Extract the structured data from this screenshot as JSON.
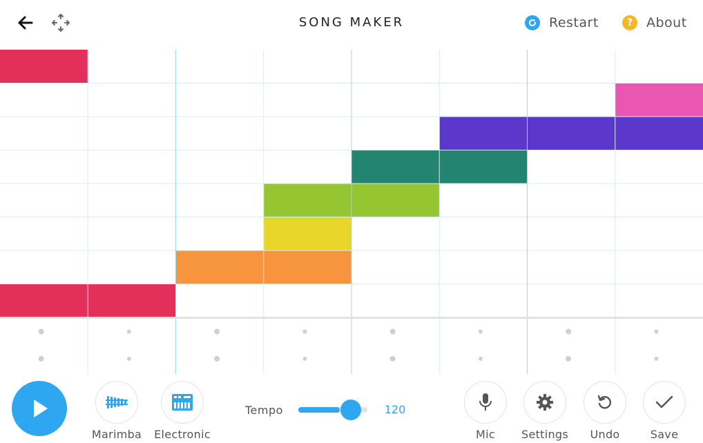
{
  "header": {
    "title": "SONG MAKER",
    "back_icon": "arrow-left-icon",
    "move_icon": "move-arrows-icon",
    "restart": {
      "label": "Restart",
      "icon": "restart-icon",
      "color": "#2fa6f0"
    },
    "about": {
      "label": "About",
      "icon": "question-icon",
      "icon_glyph": "?",
      "color": "#f5b62a"
    }
  },
  "grid": {
    "columns": 8,
    "melody_rows": 8,
    "percussion_rows": 2,
    "bar_line_columns": [
      2,
      4,
      6
    ],
    "notes": [
      {
        "row": 0,
        "col": 0,
        "color": "#e3305b"
      },
      {
        "row": 7,
        "col": 0,
        "color": "#e3305b"
      },
      {
        "row": 7,
        "col": 1,
        "color": "#e3305b"
      },
      {
        "row": 6,
        "col": 2,
        "color": "#f7953e"
      },
      {
        "row": 6,
        "col": 3,
        "color": "#f7953e"
      },
      {
        "row": 5,
        "col": 3,
        "color": "#e9d62a"
      },
      {
        "row": 4,
        "col": 3,
        "color": "#95c531"
      },
      {
        "row": 4,
        "col": 4,
        "color": "#95c531"
      },
      {
        "row": 3,
        "col": 4,
        "color": "#238470"
      },
      {
        "row": 3,
        "col": 5,
        "color": "#238470"
      },
      {
        "row": 2,
        "col": 5,
        "color": "#5b37cc"
      },
      {
        "row": 2,
        "col": 6,
        "color": "#5b37cc"
      },
      {
        "row": 2,
        "col": 7,
        "color": "#5b37cc"
      },
      {
        "row": 1,
        "col": 7,
        "color": "#e957b2"
      }
    ]
  },
  "controls": {
    "play": {
      "icon": "play-icon",
      "color": "#2fa6f0"
    },
    "marimba": {
      "label": "Marimba",
      "icon": "marimba-icon"
    },
    "electronic": {
      "label": "Electronic",
      "icon": "electronic-keyboard-icon"
    },
    "tempo": {
      "label": "Tempo",
      "value": "120",
      "level_fraction": 0.6
    },
    "mic": {
      "label": "Mic",
      "icon": "microphone-icon"
    },
    "settings": {
      "label": "Settings",
      "icon": "gear-icon"
    },
    "undo": {
      "label": "Undo",
      "icon": "undo-icon"
    },
    "save": {
      "label": "Save",
      "icon": "checkmark-icon"
    }
  },
  "colors": {
    "accent": "#2fa6f0",
    "grid_line": "#d7edf7",
    "bar_line": "#9fd8ec",
    "separator": "#e2e2e2",
    "dot": "#d0d0d0"
  }
}
